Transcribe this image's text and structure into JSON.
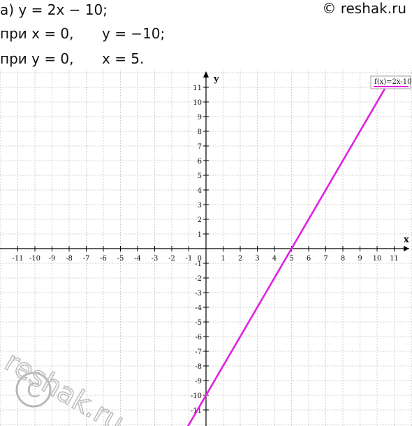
{
  "text": {
    "line1": "а) y = 2x − 10;",
    "copyright": "© reshak.ru",
    "line2_a": "при x = 0,",
    "line2_b": "y = −10;",
    "line3_a": "при y = 0,",
    "line3_b": "x = 5."
  },
  "watermark": "reshak.ru",
  "chart_data": {
    "type": "line",
    "xlabel": "x",
    "ylabel": "y",
    "xlim": [
      -12,
      12
    ],
    "ylim": [
      -12,
      12
    ],
    "x_ticks": [
      -11,
      -10,
      -9,
      -8,
      -7,
      -6,
      -5,
      -4,
      -3,
      -2,
      -1,
      1,
      2,
      3,
      4,
      5,
      6,
      7,
      8,
      9,
      10,
      11
    ],
    "y_ticks": [
      11,
      10,
      9,
      8,
      7,
      6,
      5,
      4,
      3,
      2,
      1,
      -1,
      -2,
      -3,
      -4,
      -5,
      -6,
      -7,
      -8,
      -9,
      -10,
      -11
    ],
    "origin_label": "0",
    "grid": true,
    "legend": "top-right",
    "series": [
      {
        "name": "f(x)=2x-10",
        "color": "#e020e0",
        "x": [
          -1.15,
          10.5
        ],
        "y": [
          -12.3,
          11
        ]
      }
    ]
  }
}
